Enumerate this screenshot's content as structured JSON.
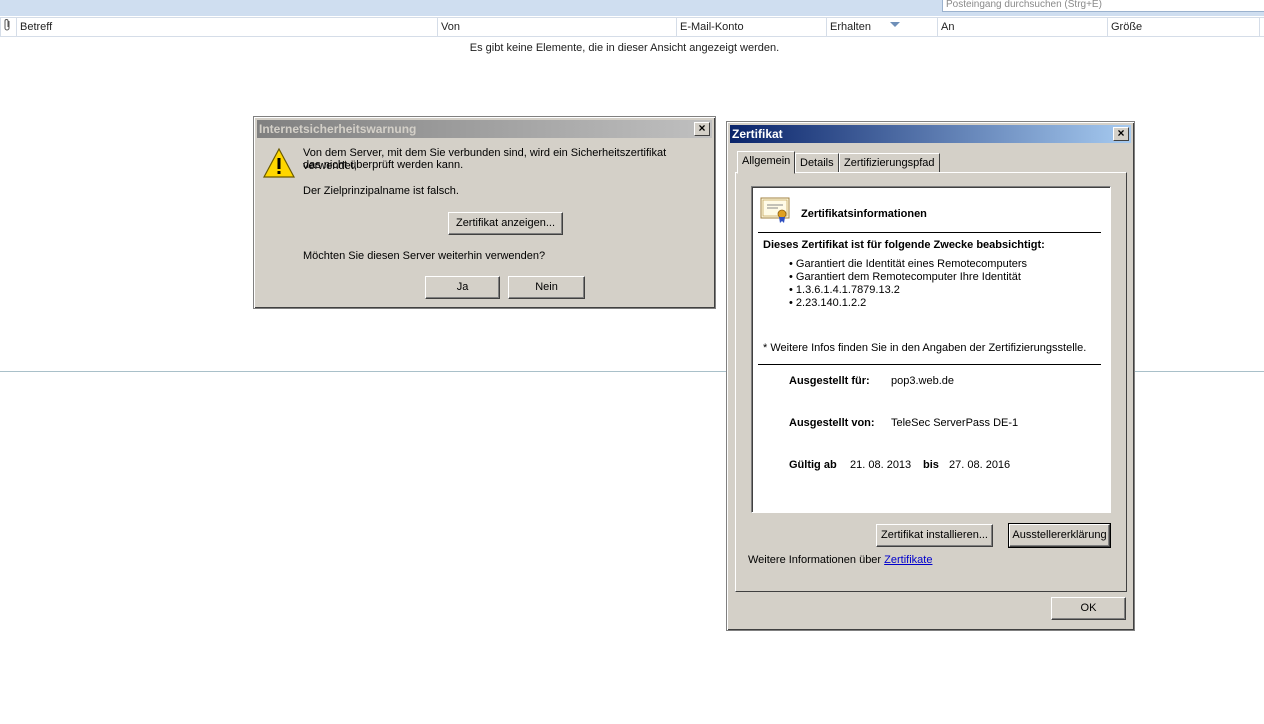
{
  "outlook": {
    "search_placeholder": "Posteingang durchsuchen (Strg+E)",
    "columns": [
      "Betreff",
      "Von",
      "E-Mail-Konto",
      "Erhalten",
      "An",
      "Größe"
    ],
    "empty_message": "Es gibt keine Elemente, die in dieser Ansicht angezeigt werden."
  },
  "warning_dialog": {
    "title": "Internetsicherheitswarnung",
    "message_line1": "Von dem Server, mit dem Sie verbunden sind, wird ein Sicherheitszertifikat verwendet,",
    "message_line2": "das nicht überprüft werden kann.",
    "detail": "Der Zielprinzipalname ist falsch.",
    "view_cert_button": "Zertifikat anzeigen...",
    "question": "Möchten Sie diesen Server weiterhin verwenden?",
    "yes_button": "Ja",
    "no_button": "Nein"
  },
  "cert_dialog": {
    "title": "Zertifikat",
    "tabs": [
      "Allgemein",
      "Details",
      "Zertifizierungspfad"
    ],
    "info_heading": "Zertifikatsinformationen",
    "purpose_heading": "Dieses Zertifikat ist für folgende Zwecke beabsichtigt:",
    "purposes": [
      "• Garantiert die Identität eines Remotecomputers",
      "• Garantiert dem Remotecomputer Ihre Identität",
      "• 1.3.6.1.4.1.7879.13.2",
      "• 2.23.140.1.2.2"
    ],
    "more_info_note": "* Weitere Infos finden Sie in den Angaben der Zertifizierungsstelle.",
    "issued_to_label": "Ausgestellt für:",
    "issued_to": "pop3.web.de",
    "issued_by_label": "Ausgestellt von:",
    "issued_by": "TeleSec ServerPass DE-1",
    "valid_from_label": "Gültig ab",
    "valid_from": "21. 08. 2013",
    "valid_to_label": "bis",
    "valid_to": "27. 08. 2016",
    "install_button": "Zertifikat installieren...",
    "issuer_statement_button": "Ausstellererklärung",
    "more_info_prefix": "Weitere Informationen über",
    "more_info_link": "Zertifikate",
    "ok_button": "OK"
  }
}
